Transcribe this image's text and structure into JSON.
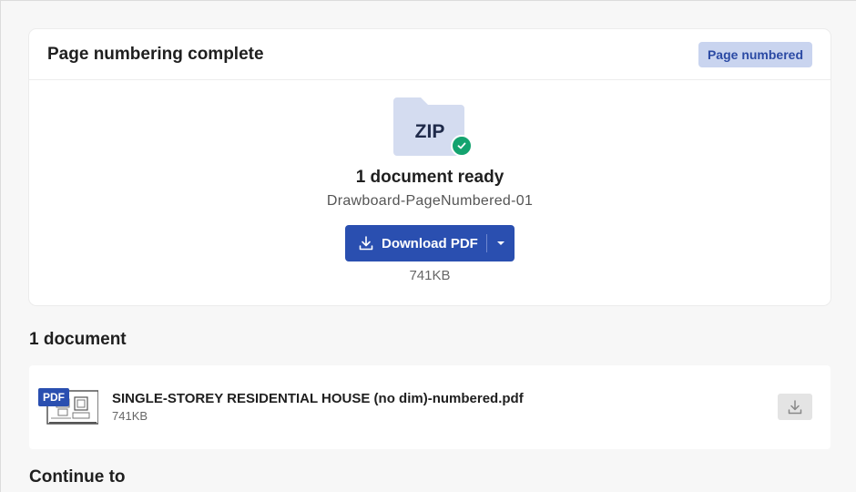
{
  "result_card": {
    "title": "Page numbering complete",
    "badge": "Page numbered",
    "archive_label": "ZIP",
    "ready_text": "1 document ready",
    "output_name": "Drawboard-PageNumbered-01",
    "download_label": "Download PDF",
    "download_size": "741KB"
  },
  "documents": {
    "heading": "1 document",
    "items": [
      {
        "type_tag": "PDF",
        "name": "SINGLE-STOREY RESIDENTIAL HOUSE (no dim)-numbered.pdf",
        "size": "741KB"
      }
    ]
  },
  "continue": {
    "heading": "Continue to"
  },
  "colors": {
    "accent": "#2a4fb0",
    "badge_bg": "#c9d4ef",
    "success": "#14a36f",
    "folder": "#d4dcf0"
  },
  "icons": [
    "zip-folder-icon",
    "check-icon",
    "download-icon",
    "chevron-down-icon",
    "pdf-thumbnail-icon"
  ]
}
